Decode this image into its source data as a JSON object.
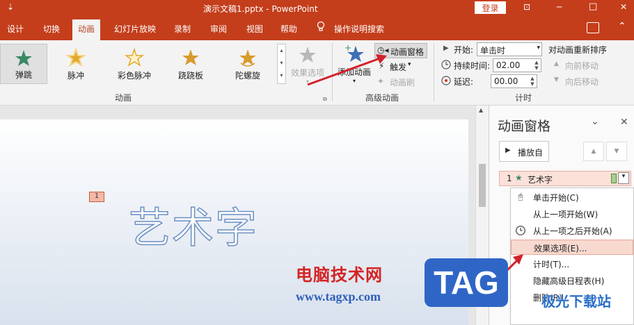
{
  "titlebar": {
    "title": "演示文稿1.pptx  -  PowerPoint",
    "login": "登录",
    "restore_glyph": "⊡",
    "min_glyph": "─",
    "max_glyph": "□",
    "close_glyph": "✕",
    "qat_glyph": "⇣"
  },
  "tabs": [
    "设计",
    "切换",
    "动画",
    "幻灯片放映",
    "录制",
    "审阅",
    "视图",
    "帮助",
    "操作说明搜索"
  ],
  "active_tab": "动画",
  "ribbon": {
    "animations": [
      {
        "label": "弹跳",
        "icon": "star-green-icon",
        "color": "#3a8a66"
      },
      {
        "label": "脉冲",
        "icon": "star-gold-icon",
        "color": "#e3a92a"
      },
      {
        "label": "彩色脉冲",
        "icon": "star-outline-icon",
        "color": "#e3a92a"
      },
      {
        "label": "跷跷板",
        "icon": "star-gold-icon",
        "color": "#d89b2e"
      },
      {
        "label": "陀螺旋",
        "icon": "star-spin-icon",
        "color": "#d89b2e"
      }
    ],
    "effect_options": "效果选项",
    "group_animation": "动画",
    "add_animation": "添加动画",
    "animation_pane_btn": "动画窗格",
    "trigger": "触发",
    "animation_painter": "动画刷",
    "group_advanced": "高级动画",
    "start_label": "开始:",
    "start_value": "单击时",
    "duration_label": "持续时间:",
    "duration_value": "02.00",
    "delay_label": "延迟:",
    "delay_value": "00.00",
    "group_timing": "计时",
    "reorder_title": "对动画重新排序",
    "move_earlier": "向前移动",
    "move_later": "向后移动"
  },
  "slide": {
    "marker": "1",
    "text": "艺术字"
  },
  "pane": {
    "title": "动画窗格",
    "play_from": "播放自",
    "item_index": "1",
    "item_label": "艺术字",
    "menu": [
      {
        "label": "单击开始(C)",
        "icon": "mouse-icon"
      },
      {
        "label": "从上一项开始(W)",
        "icon": ""
      },
      {
        "label": "从上一项之后开始(A)",
        "icon": "clock-icon"
      },
      {
        "label": "效果选项(E)...",
        "icon": ""
      },
      {
        "label": "计时(T)...",
        "icon": ""
      },
      {
        "label": "隐藏高级日程表(H)",
        "icon": ""
      },
      {
        "label": "删除(R)",
        "icon": ""
      }
    ],
    "highlighted_index": 3
  },
  "watermark": {
    "site_name": "电脑技术网",
    "url": "www.tagxp.com",
    "badge": "TAG",
    "brand": "极光下载站"
  },
  "colors": {
    "accent": "#c43e1c",
    "red_arrow": "#d3222a",
    "menu_highlight": "#f8d9d0"
  }
}
